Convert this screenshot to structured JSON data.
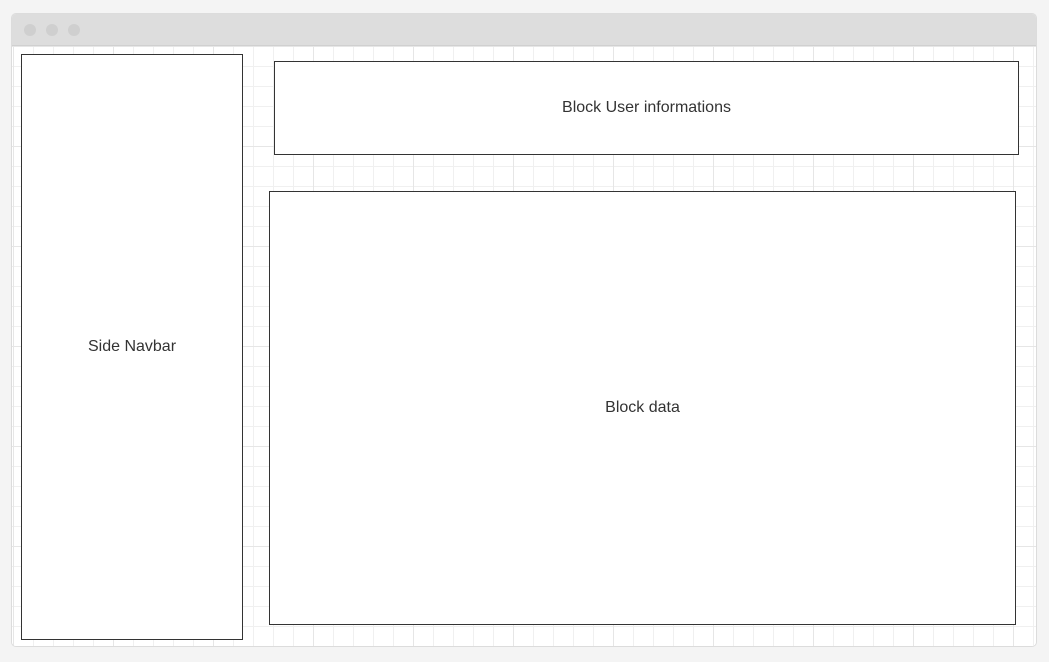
{
  "window": {
    "controls": [
      "window-dot",
      "window-dot",
      "window-dot"
    ],
    "colors": {
      "titlebar": "#dddddd",
      "border": "#333333",
      "text": "#333333"
    }
  },
  "diagram": {
    "side_navbar": "Side Navbar",
    "user_info_block": "Block User informations",
    "data_block": "Block data"
  }
}
